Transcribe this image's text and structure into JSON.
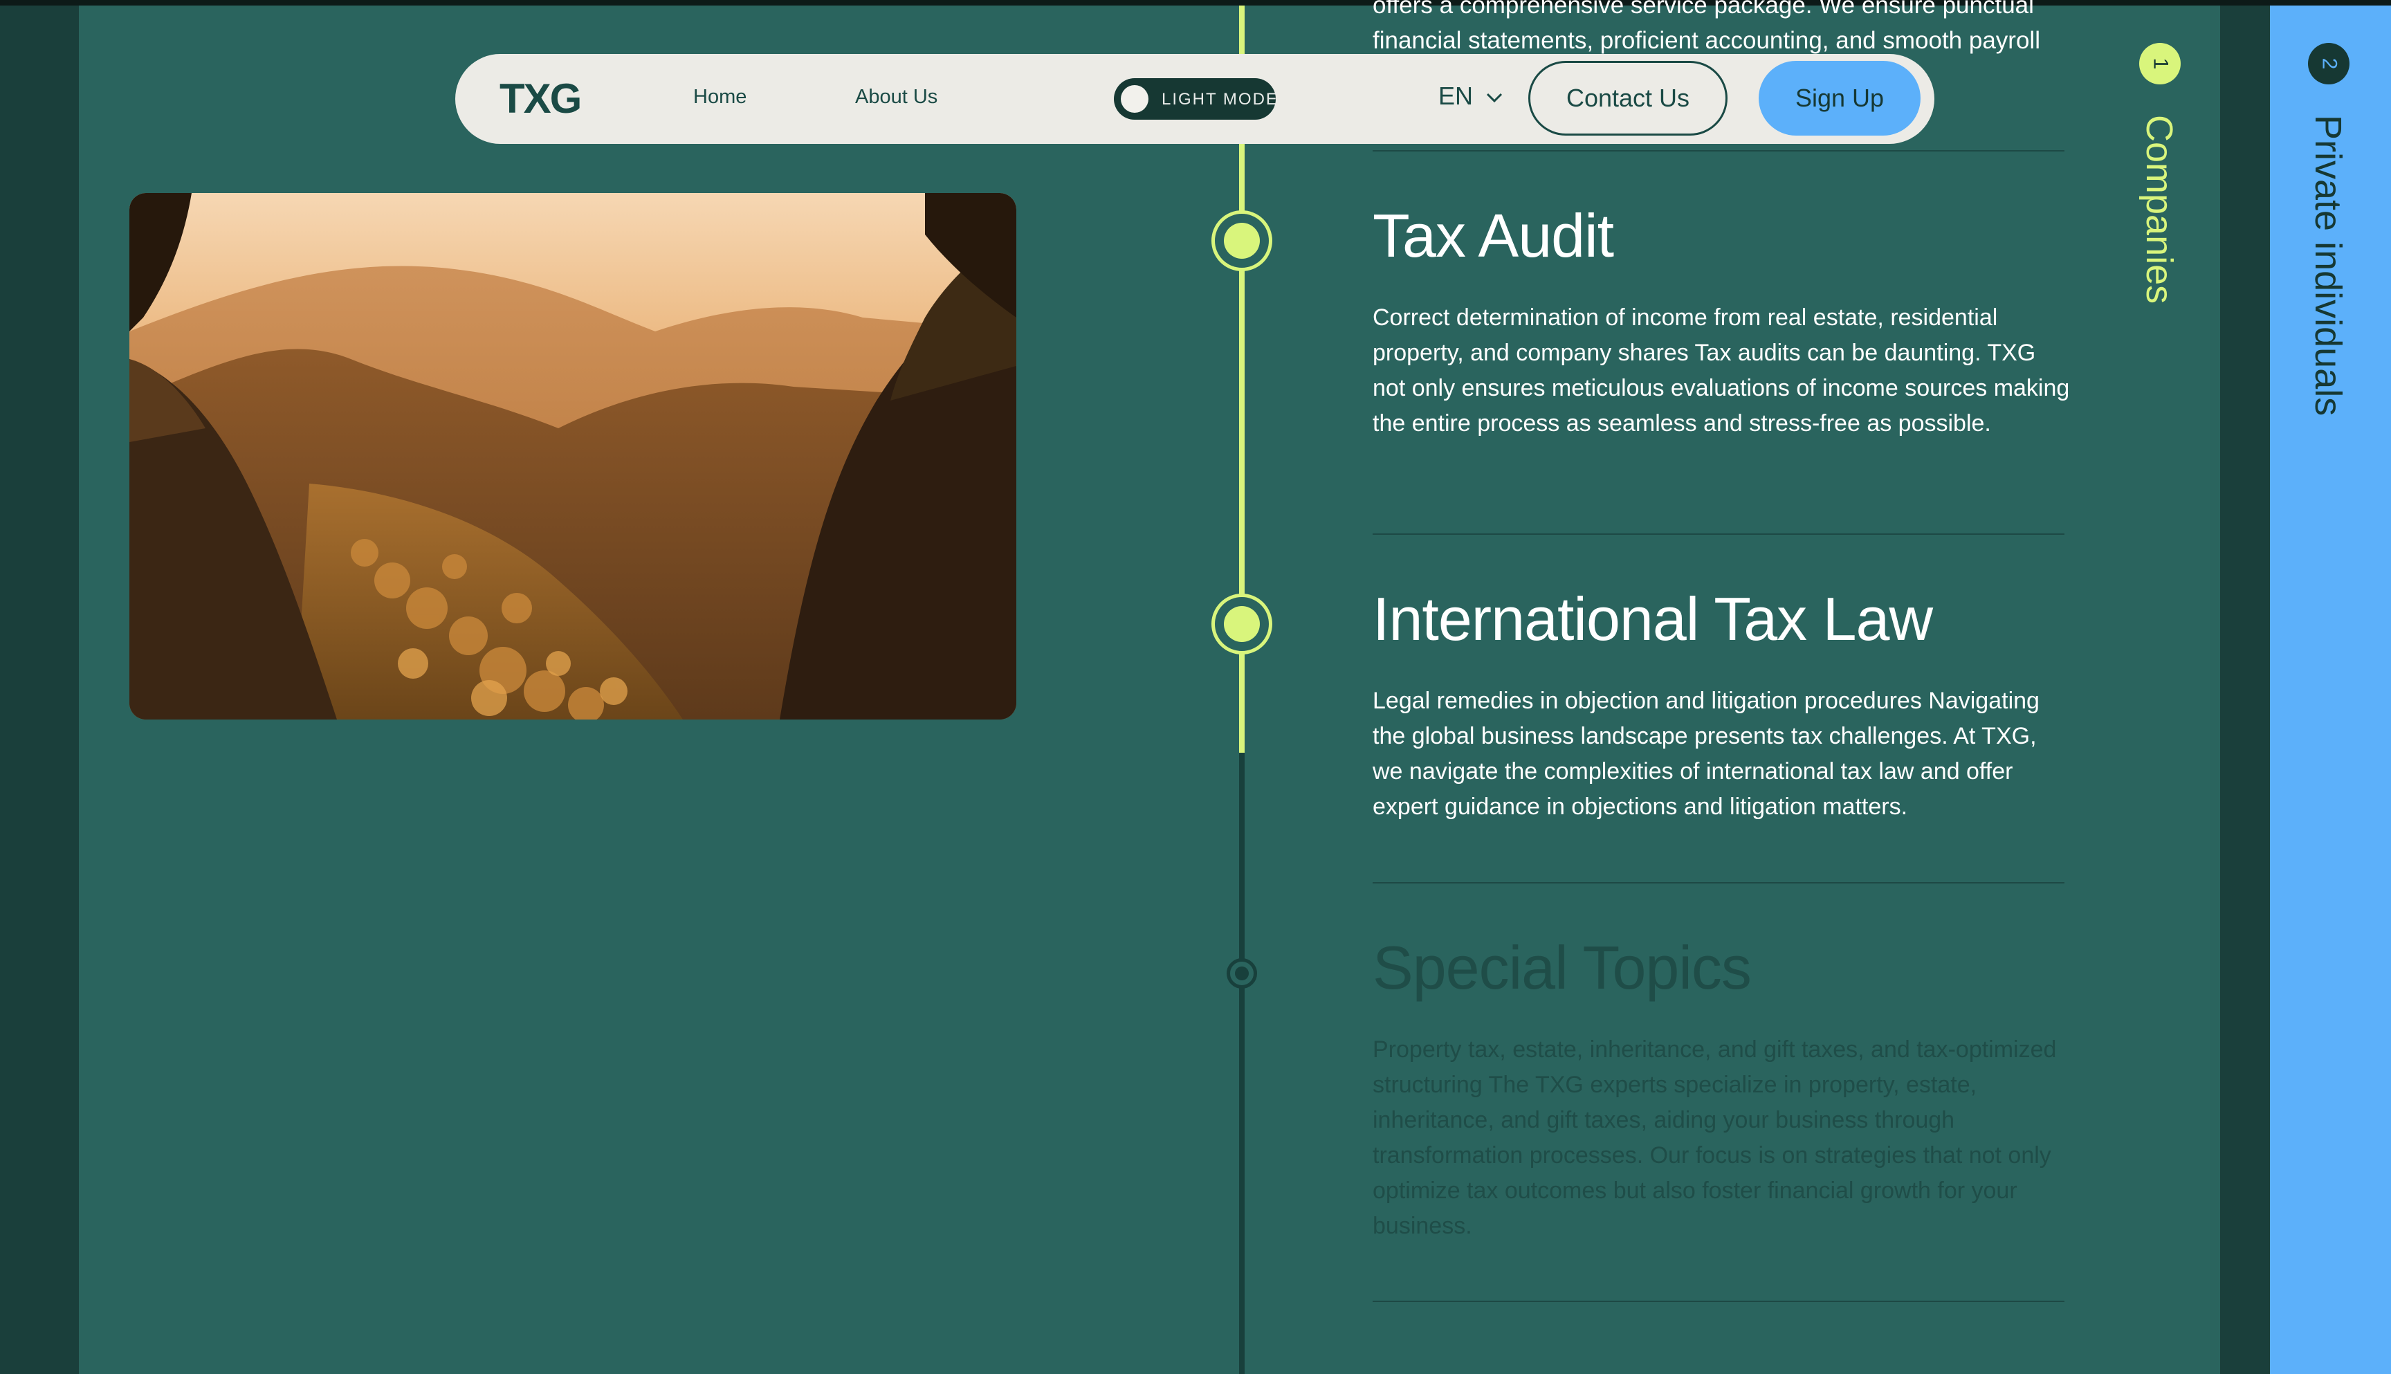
{
  "nav": {
    "logo": "TXG",
    "links": [
      "Home",
      "About Us"
    ],
    "theme_toggle_label": "LIGHT MODE",
    "language": "EN",
    "contact_label": "Contact Us",
    "signup_label": "Sign Up"
  },
  "content": {
    "partial_text": "offers a comprehensive service package. We ensure punctual financial statements, proficient accounting, and smooth payroll",
    "sections": [
      {
        "title": "Tax Audit",
        "body": "Correct determination of income from real estate, residential property, and company shares Tax audits can be daunting. TXG not only ensures meticulous evaluations of income sources making the entire process as seamless and stress-free as possible."
      },
      {
        "title": "International Tax Law",
        "body": "Legal remedies in objection and litigation procedures Navigating the global business landscape presents tax challenges. At TXG, we navigate the complexities of international tax law and offer expert guidance in objections and litigation matters."
      },
      {
        "title": "Special Topics",
        "body": "Property tax, estate, inheritance, and gift taxes, and tax-optimized structuring The TXG experts specialize in property, estate, inheritance, and gift taxes, aiding your business through transformation processes. Our focus is on strategies that not only optimize tax outcomes but also foster financial growth for your business."
      }
    ]
  },
  "tabs": [
    {
      "number": "1",
      "label": "Companies"
    },
    {
      "number": "2",
      "label": "Private individuals"
    }
  ],
  "colors": {
    "accent": "#d9f57c",
    "blue": "#5cb0fa",
    "main_bg": "#2a645e",
    "dark": "#163833"
  }
}
